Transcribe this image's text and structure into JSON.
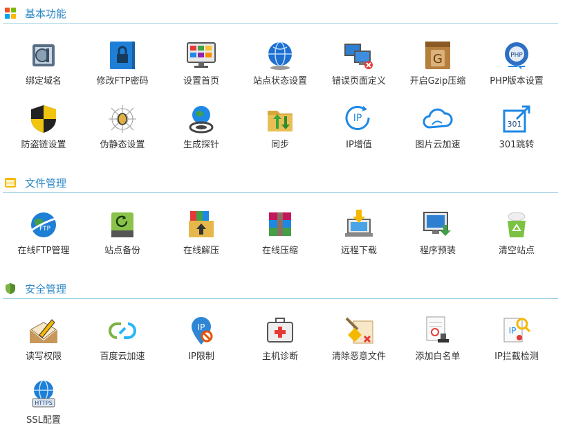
{
  "sections": [
    {
      "title": "基本功能",
      "icon": "windows-blocks-icon",
      "items": [
        {
          "label": "绑定域名",
          "icon": "bind-domain-icon"
        },
        {
          "label": "修改FTP密码",
          "icon": "ftp-password-lock-icon"
        },
        {
          "label": "设置首页",
          "icon": "homepage-monitor-icon"
        },
        {
          "label": "站点状态设置",
          "icon": "globe-status-icon"
        },
        {
          "label": "错误页面定义",
          "icon": "error-page-computers-icon"
        },
        {
          "label": "开启Gzip压缩",
          "icon": "gzip-box-icon"
        },
        {
          "label": "PHP版本设置",
          "icon": "php-version-icon"
        },
        {
          "label": "防盗链设置",
          "icon": "anti-leech-shield-icon"
        },
        {
          "label": "伪静态设置",
          "icon": "rewrite-spider-icon"
        },
        {
          "label": "生成探针",
          "icon": "probe-globe-icon"
        },
        {
          "label": "同步",
          "icon": "sync-folder-icon"
        },
        {
          "label": "IP增值",
          "icon": "ip-plus-icon"
        },
        {
          "label": "图片云加速",
          "icon": "image-cloud-icon"
        },
        {
          "label": "301跳转",
          "icon": "redirect-301-icon"
        }
      ]
    },
    {
      "title": "文件管理",
      "icon": "file-cabinet-icon",
      "items": [
        {
          "label": "在线FTP管理",
          "icon": "ftp-globe-icon"
        },
        {
          "label": "站点备份",
          "icon": "backup-drive-icon"
        },
        {
          "label": "在线解压",
          "icon": "unzip-box-icon"
        },
        {
          "label": "在线压缩",
          "icon": "rar-archive-icon"
        },
        {
          "label": "远程下载",
          "icon": "remote-download-laptop-icon"
        },
        {
          "label": "程序预装",
          "icon": "program-install-icon"
        },
        {
          "label": "清空站点",
          "icon": "recycle-bin-icon"
        }
      ]
    },
    {
      "title": "安全管理",
      "icon": "security-shield-icon",
      "items": [
        {
          "label": "读写权限",
          "icon": "read-write-pen-icon"
        },
        {
          "label": "百度云加速",
          "icon": "baidu-cloud-icon"
        },
        {
          "label": "IP限制",
          "icon": "ip-block-icon"
        },
        {
          "label": "主机诊断",
          "icon": "first-aid-kit-icon"
        },
        {
          "label": "清除恶意文件",
          "icon": "clean-broom-icon"
        },
        {
          "label": "添加白名单",
          "icon": "whitelist-stamp-icon"
        },
        {
          "label": "IP拦截检测",
          "icon": "ip-detect-magnifier-icon"
        },
        {
          "label": "SSL配置",
          "icon": "https-globe-icon"
        }
      ]
    }
  ],
  "colors": {
    "accent": "#2b88c6",
    "divider": "#9ccfe3"
  }
}
